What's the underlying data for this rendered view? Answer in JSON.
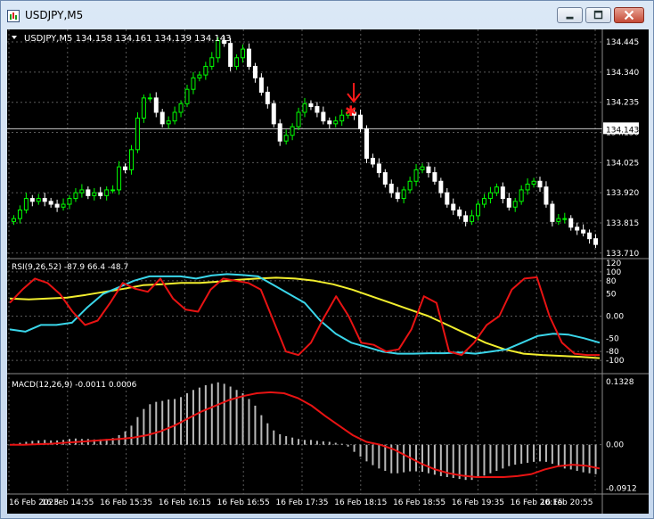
{
  "window": {
    "title": "USDJPY,M5"
  },
  "chart_data": [
    {
      "type": "candlestick",
      "header": "USDJPY,M5  134.158 134.161 134.139 134.143",
      "symbol": "USDJPY,M5",
      "ohlc": [
        "134.158",
        "134.161",
        "134.139",
        "134.143"
      ],
      "price_ticks": [
        "134.445",
        "134.340",
        "134.235",
        "134.130",
        "134.025",
        "133.920",
        "133.815",
        "133.710"
      ],
      "current_price_label": "134.143",
      "current_price": 134.143,
      "ylim": [
        133.7,
        134.47
      ],
      "close": [
        133.83,
        133.86,
        133.9,
        133.89,
        133.9,
        133.89,
        133.88,
        133.87,
        133.88,
        133.9,
        133.92,
        133.93,
        133.91,
        133.92,
        133.91,
        133.93,
        133.93,
        134.01,
        134.0,
        134.07,
        134.18,
        134.25,
        134.25,
        134.2,
        134.16,
        134.17,
        134.2,
        134.23,
        134.28,
        134.32,
        134.33,
        134.36,
        134.39,
        134.45,
        134.44,
        134.36,
        134.39,
        134.42,
        134.36,
        134.32,
        134.27,
        134.23,
        134.16,
        134.1,
        134.12,
        134.15,
        134.2,
        134.23,
        134.22,
        134.2,
        134.17,
        134.16,
        134.17,
        134.19,
        134.2,
        134.19,
        134.143,
        134.04,
        134.02,
        133.99,
        133.95,
        133.92,
        133.9,
        133.93,
        133.96,
        134.0,
        134.01,
        133.99,
        133.96,
        133.92,
        133.88,
        133.86,
        133.84,
        133.82,
        133.84,
        133.88,
        133.9,
        133.92,
        133.94,
        133.9,
        133.87,
        133.89,
        133.93,
        133.95,
        133.96,
        133.94,
        133.88,
        133.82,
        133.83,
        133.83,
        133.8,
        133.79,
        133.78,
        133.76,
        133.74
      ],
      "rsi": {
        "label": "RSI(9,26,52) -87.9 66.4 -48.7",
        "axis_ticks": [
          "120",
          "100",
          "80",
          "50",
          "0.00",
          "-50",
          "-80",
          "-100"
        ],
        "ylim": [
          -120,
          120
        ],
        "fast": [
          30,
          60,
          85,
          75,
          50,
          10,
          -20,
          -10,
          30,
          75,
          62,
          55,
          85,
          40,
          15,
          10,
          60,
          85,
          80,
          75,
          60,
          -10,
          -80,
          -88,
          -60,
          -5,
          45,
          0,
          -60,
          -65,
          -80,
          -75,
          -30,
          45,
          30,
          -80,
          -88,
          -60,
          -20,
          0,
          60,
          85,
          88,
          0,
          -60,
          -85,
          -88,
          -88
        ],
        "mid": [
          -30,
          -35,
          -20,
          -20,
          -15,
          20,
          50,
          65,
          80,
          90,
          90,
          90,
          85,
          92,
          95,
          93,
          90,
          70,
          50,
          30,
          -10,
          -40,
          -60,
          -70,
          -80,
          -85,
          -85,
          -84,
          -84,
          -82,
          -85,
          -80,
          -75,
          -60,
          -45,
          -40,
          -42,
          -50,
          -60
        ],
        "slow": [
          40,
          38,
          40,
          42,
          48,
          55,
          62,
          70,
          72,
          75,
          75,
          78,
          82,
          85,
          87,
          85,
          80,
          72,
          60,
          45,
          30,
          15,
          0,
          -20,
          -40,
          -60,
          -75,
          -85,
          -88,
          -90,
          -92,
          -95
        ]
      },
      "macd": {
        "label": "MACD(12,26,9) -0.0011 0.0006",
        "axis_ticks": [
          "0.1328",
          "0.00",
          "-0.0912"
        ],
        "ylim": [
          -0.098,
          0.138
        ],
        "hist": [
          0.002,
          0.004,
          0.006,
          0.008,
          0.009,
          0.01,
          0.009,
          0.009,
          0.01,
          0.012,
          0.013,
          0.012,
          0.012,
          0.011,
          0.011,
          0.012,
          0.014,
          0.02,
          0.028,
          0.04,
          0.058,
          0.075,
          0.085,
          0.09,
          0.092,
          0.095,
          0.096,
          0.1,
          0.108,
          0.115,
          0.12,
          0.125,
          0.128,
          0.131,
          0.128,
          0.122,
          0.115,
          0.108,
          0.096,
          0.082,
          0.062,
          0.045,
          0.03,
          0.022,
          0.018,
          0.015,
          0.012,
          0.01,
          0.01,
          0.008,
          0.007,
          0.006,
          0.004,
          0.002,
          -0.004,
          -0.015,
          -0.025,
          -0.035,
          -0.043,
          -0.05,
          -0.055,
          -0.06,
          -0.06,
          -0.058,
          -0.056,
          -0.056,
          -0.057,
          -0.06,
          -0.063,
          -0.066,
          -0.068,
          -0.07,
          -0.072,
          -0.074,
          -0.074,
          -0.07,
          -0.065,
          -0.06,
          -0.055,
          -0.05,
          -0.045,
          -0.042,
          -0.04,
          -0.038,
          -0.036,
          -0.035,
          -0.036,
          -0.04,
          -0.045,
          -0.05,
          -0.052,
          -0.055,
          -0.058,
          -0.06,
          -0.062
        ],
        "signal": [
          0.0,
          0.0,
          0.001,
          0.002,
          0.004,
          0.006,
          0.008,
          0.01,
          0.012,
          0.015,
          0.02,
          0.028,
          0.04,
          0.055,
          0.07,
          0.082,
          0.094,
          0.102,
          0.108,
          0.11,
          0.108,
          0.098,
          0.082,
          0.06,
          0.04,
          0.02,
          0.006,
          0.0,
          -0.01,
          -0.025,
          -0.04,
          -0.052,
          -0.06,
          -0.065,
          -0.068,
          -0.068,
          -0.068,
          -0.066,
          -0.062,
          -0.052,
          -0.045,
          -0.042,
          -0.044,
          -0.05
        ]
      },
      "time_ticks": [
        "16 Feb 2023",
        "16 Feb 14:55",
        "16 Feb 15:35",
        "16 Feb 16:15",
        "16 Feb 16:55",
        "16 Feb 17:35",
        "16 Feb 18:15",
        "16 Feb 18:55",
        "16 Feb 19:35",
        "16 Feb 20:15",
        "16 Feb 20:55"
      ],
      "colors": {
        "background": "#000000",
        "bull": "#00ff00",
        "bear": "#ffffff",
        "rsi_fast": "#e81313",
        "rsi_mid": "#3ad6ea",
        "rsi_slow": "#f2ee2e",
        "macd_hist": "#b9b9b9",
        "macd_signal": "#e81313",
        "marker": "#ff1a1a",
        "axis_text": "#ffffff"
      }
    }
  ]
}
